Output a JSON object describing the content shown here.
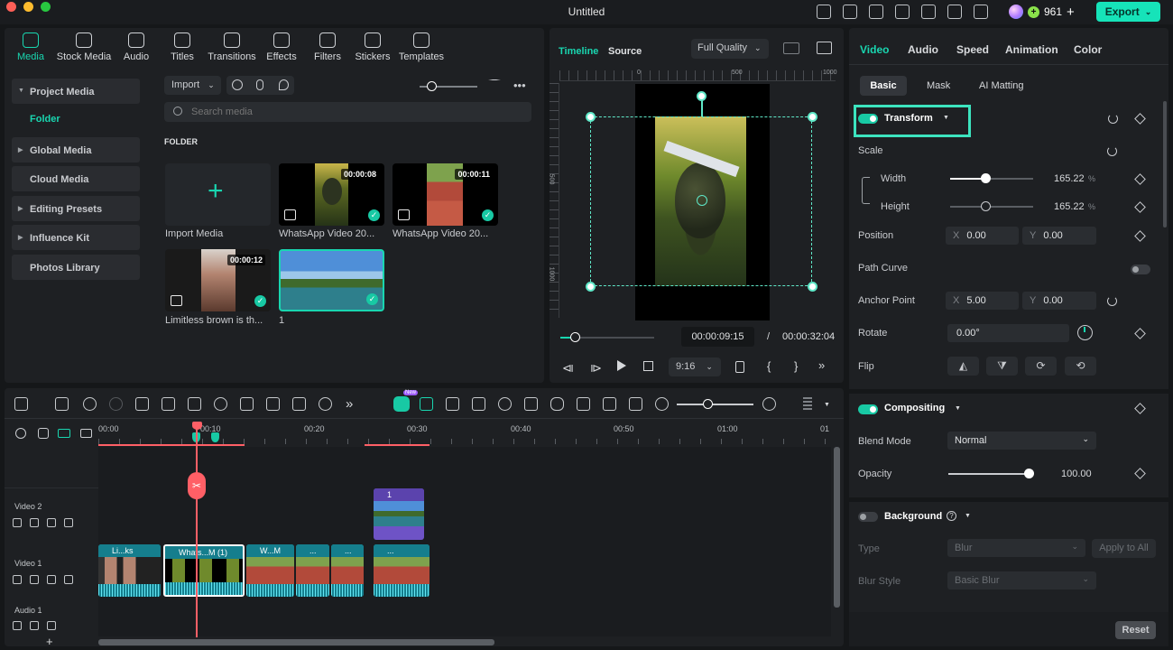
{
  "window": {
    "title": "Untitled",
    "credits": "961",
    "export_label": "Export"
  },
  "media_tabs": [
    "Media",
    "Stock Media",
    "Audio",
    "Titles",
    "Transitions",
    "Effects",
    "Filters",
    "Stickers",
    "Templates"
  ],
  "sidebar": {
    "items": [
      "Project Media",
      "Folder",
      "Global Media",
      "Cloud Media",
      "Editing Presets",
      "Influence Kit",
      "Photos Library"
    ]
  },
  "library": {
    "import_label": "Import",
    "search_placeholder": "Search media",
    "folder_heading": "FOLDER",
    "items": [
      {
        "label": "Import Media",
        "duration": ""
      },
      {
        "label": "WhatsApp Video 20...",
        "duration": "00:00:08"
      },
      {
        "label": "WhatsApp Video 20...",
        "duration": "00:00:11"
      },
      {
        "label": "Limitless brown is th...",
        "duration": "00:00:12"
      },
      {
        "label": "1",
        "duration": ""
      }
    ]
  },
  "preview": {
    "tab_timeline": "Timeline",
    "tab_source": "Source",
    "quality": "Full Quality",
    "ruler": [
      "0",
      "500",
      "1000"
    ],
    "vruler": [
      "500",
      "1000"
    ],
    "current_time": "00:00:09:15",
    "separator": "/",
    "total_time": "00:00:32:04",
    "aspect": "9:16",
    "progress": 0.15
  },
  "properties": {
    "tabs": [
      "Video",
      "Audio",
      "Speed",
      "Animation",
      "Color"
    ],
    "subtabs": [
      "Basic",
      "Mask",
      "AI Matting"
    ],
    "transform_label": "Transform",
    "scale_label": "Scale",
    "width_label": "Width",
    "width_value": "165.22",
    "height_label": "Height",
    "height_value": "165.22",
    "unit": "%",
    "position_label": "Position",
    "pos_x": "0.00",
    "pos_y": "0.00",
    "x": "X",
    "y": "Y",
    "path_curve_label": "Path Curve",
    "anchor_label": "Anchor Point",
    "anchor_x": "5.00",
    "anchor_y": "0.00",
    "rotate_label": "Rotate",
    "rotate_value": "0.00°",
    "flip_label": "Flip",
    "compositing_label": "Compositing",
    "blend_label": "Blend Mode",
    "blend_value": "Normal",
    "opacity_label": "Opacity",
    "opacity_value": "100.00",
    "background_label": "Background",
    "type_label": "Type",
    "type_value": "Blur",
    "apply_all": "Apply to All",
    "blur_style_label": "Blur Style",
    "blur_style_value": "Basic Blur",
    "reset_label": "Reset"
  },
  "timeline": {
    "ruler": [
      "00:00",
      "00:10",
      "00:20",
      "00:30",
      "00:40",
      "00:50",
      "01:00",
      "01"
    ],
    "new_badge": "New",
    "tracks": [
      "Video 2",
      "Video 1",
      "Audio 1"
    ],
    "clips": [
      {
        "name": "Li...ks"
      },
      {
        "name": "Whats...M (1)"
      },
      {
        "name": "W...M"
      },
      {
        "name": "..."
      },
      {
        "name": "..."
      },
      {
        "name": "..."
      },
      {
        "name": "1"
      }
    ]
  },
  "colors": {
    "accent": "#19d6b0",
    "playhead": "#ff5f66"
  }
}
